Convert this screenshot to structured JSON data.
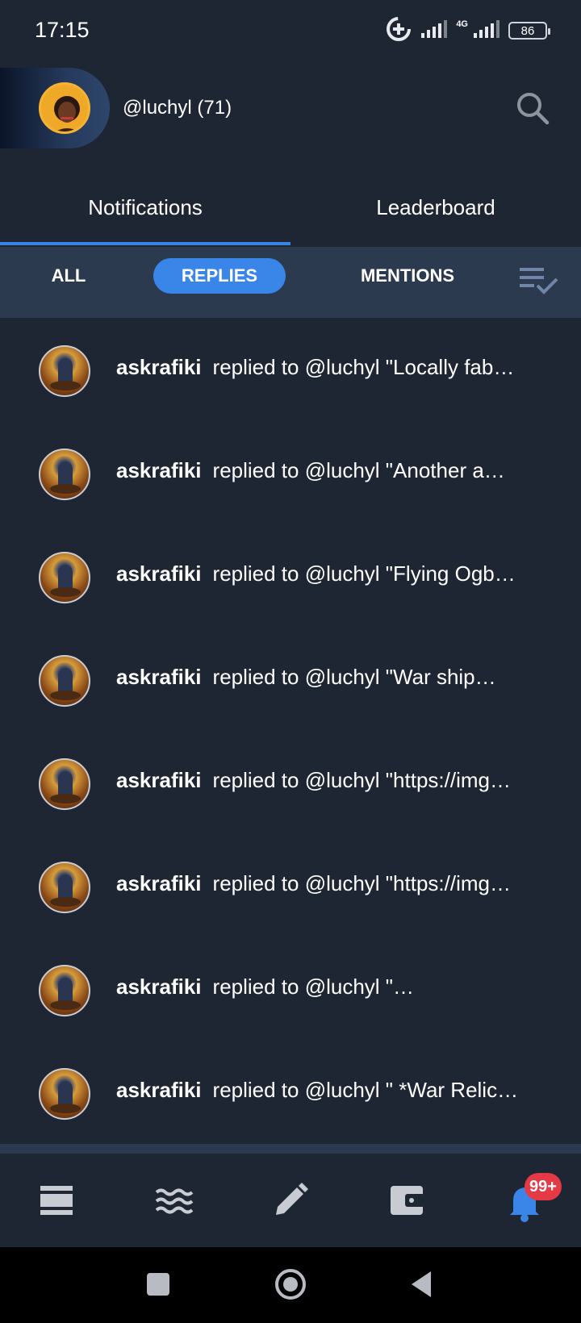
{
  "status_bar": {
    "time": "17:15",
    "network_label": "4G",
    "battery": "86"
  },
  "profile": {
    "username": "@luchyl (71)"
  },
  "tabs": [
    {
      "label": "Notifications",
      "active": true
    },
    {
      "label": "Leaderboard",
      "active": false
    }
  ],
  "filters": [
    {
      "label": "ALL",
      "active": false
    },
    {
      "label": "REPLIES",
      "active": true
    },
    {
      "label": "MENTIONS",
      "active": false
    }
  ],
  "notifications": [
    {
      "user": "askrafiki",
      "text": "replied to @luchyl \"Locally fab…"
    },
    {
      "user": "askrafiki",
      "text": "replied to @luchyl \"Another a…"
    },
    {
      "user": "askrafiki",
      "text": "replied to @luchyl \"Flying Ogb…"
    },
    {
      "user": "askrafiki",
      "text": "replied to @luchyl \"War ship…"
    },
    {
      "user": "askrafiki",
      "text": "replied to @luchyl \"https://img…"
    },
    {
      "user": "askrafiki",
      "text": "replied to @luchyl \"https://img…"
    },
    {
      "user": "askrafiki",
      "text": "replied to @luchyl \"…"
    },
    {
      "user": "askrafiki",
      "text": "replied to @luchyl \" *War Relic…"
    }
  ],
  "bottom_nav": {
    "items": [
      "feed-icon",
      "waves-icon",
      "pencil-icon",
      "wallet-icon",
      "bell-icon"
    ],
    "badge": "99+"
  },
  "colors": {
    "background": "#1e2634",
    "accent": "#3a86e8",
    "filter_bar": "#2c3a50",
    "badge": "#e53945"
  }
}
